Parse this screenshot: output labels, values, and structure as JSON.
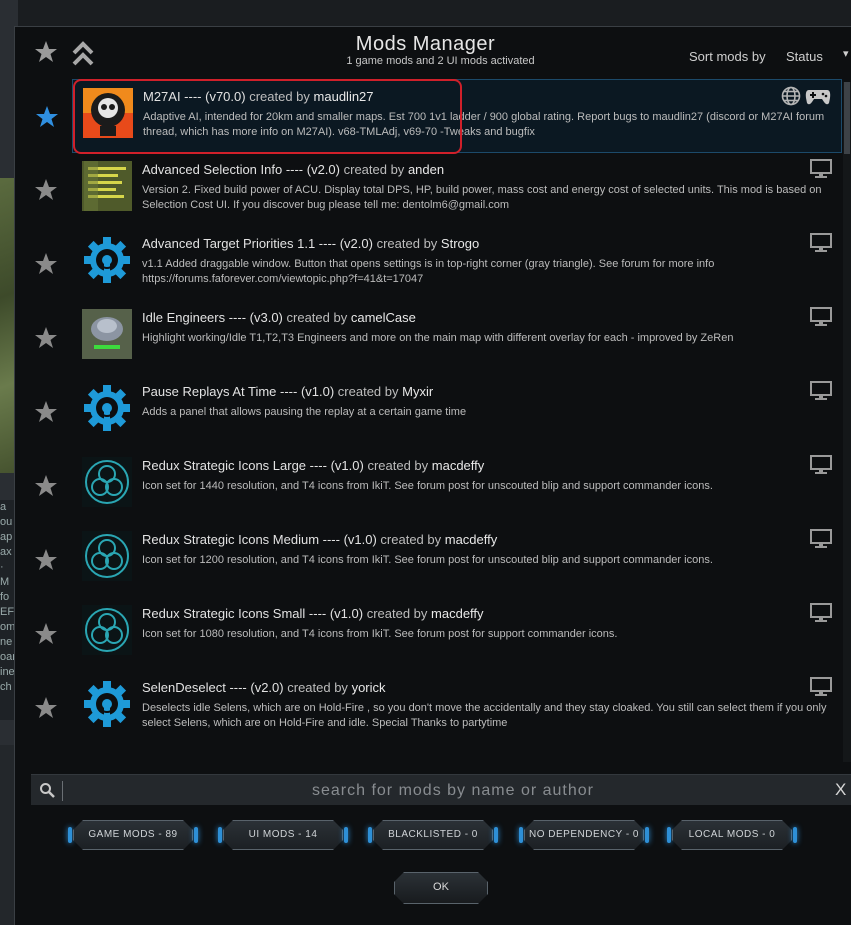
{
  "header": {
    "title": "Mods Manager",
    "subtitle": "1 game mods and 2 UI mods activated",
    "sort_label": "Sort mods by",
    "sort_value": "Status"
  },
  "mods": [
    {
      "name": "M27AI ---- (v70.0)",
      "by": "created by",
      "author": "maudlin27",
      "desc": "Adaptive AI, intended for 20km and smaller maps. Est 700 1v1 ladder / 900 global rating. Report bugs to maudlin27 (discord or M27AI forum thread, which has more info on M27AI). v68-TMLAdj, v69-70 -Tweaks and bugfix",
      "type": "game",
      "favorite": true
    },
    {
      "name": "Advanced Selection Info ---- (v2.0)",
      "by": "created by",
      "author": "anden",
      "desc": "Version 2. Fixed build power of ACU. Display total DPS, HP, build power, mass cost and energy cost of selected units. This mod is based on Selection Cost UI. If you discover bug please tell me: dentolm6@gmail.com",
      "type": "ui",
      "favorite": false
    },
    {
      "name": "Advanced Target Priorities 1.1 ---- (v2.0)",
      "by": "created by",
      "author": "Strogo",
      "desc": "v1.1 Added draggable window. Button that opens settings is in top-right corner (gray triangle). See forum for more info https://forums.faforever.com/viewtopic.php?f=41&t=17047",
      "type": "ui",
      "favorite": false
    },
    {
      "name": "Idle Engineers ---- (v3.0)",
      "by": "created by",
      "author": "camelCase",
      "desc": "Highlight working/Idle T1,T2,T3 Engineers and more on the main map with different overlay for each - improved by ZeRen",
      "type": "ui",
      "favorite": false
    },
    {
      "name": "Pause Replays At Time ---- (v1.0)",
      "by": "created by",
      "author": "Myxir",
      "desc": "Adds a panel that allows pausing the replay at a certain game time",
      "type": "ui",
      "favorite": false
    },
    {
      "name": "Redux Strategic Icons Large ---- (v1.0)",
      "by": "created by",
      "author": "macdeffy",
      "desc": "Icon set for 1440 resolution, and T4 icons from IkiT. See forum post for unscouted blip and support commander icons.",
      "type": "ui",
      "favorite": false
    },
    {
      "name": "Redux Strategic Icons Medium ---- (v1.0)",
      "by": "created by",
      "author": "macdeffy",
      "desc": "Icon set for 1200 resolution, and T4 icons from IkiT. See forum post for unscouted blip and support commander icons.",
      "type": "ui",
      "favorite": false
    },
    {
      "name": "Redux Strategic Icons Small ---- (v1.0)",
      "by": "created by",
      "author": "macdeffy",
      "desc": "Icon set for 1080 resolution, and T4 icons from IkiT. See forum post for support commander icons.",
      "type": "ui",
      "favorite": false
    },
    {
      "name": "SelenDeselect ---- (v2.0)",
      "by": "created by",
      "author": "yorick",
      "desc": "Deselects idle Selens, which are on Hold-Fire , so you don't move the accidentally and they stay cloaked. You still can select them if you only select Selens, which are on Hold-Fire and idle. Special Thanks to partytime",
      "type": "ui",
      "favorite": false
    }
  ],
  "search": {
    "placeholder": "search for mods by name or author",
    "clear": "X"
  },
  "filters": [
    "GAME MODS - 89",
    "UI MODS - 14",
    "BLACKLISTED - 0",
    "NO DEPENDENCY - 0",
    "LOCAL MODS - 0"
  ],
  "ok_label": "OK",
  "colors": {
    "accent": "#2e8fd6",
    "favorite": "#2f8fe0",
    "highlight": "#d0202a"
  },
  "background": {
    "side_text": [
      "a",
      "ou",
      "ap",
      "ax",
      "· M",
      "",
      "fo",
      "EF",
      "om",
      "ne",
      "oar",
      "ine",
      "ch"
    ]
  }
}
